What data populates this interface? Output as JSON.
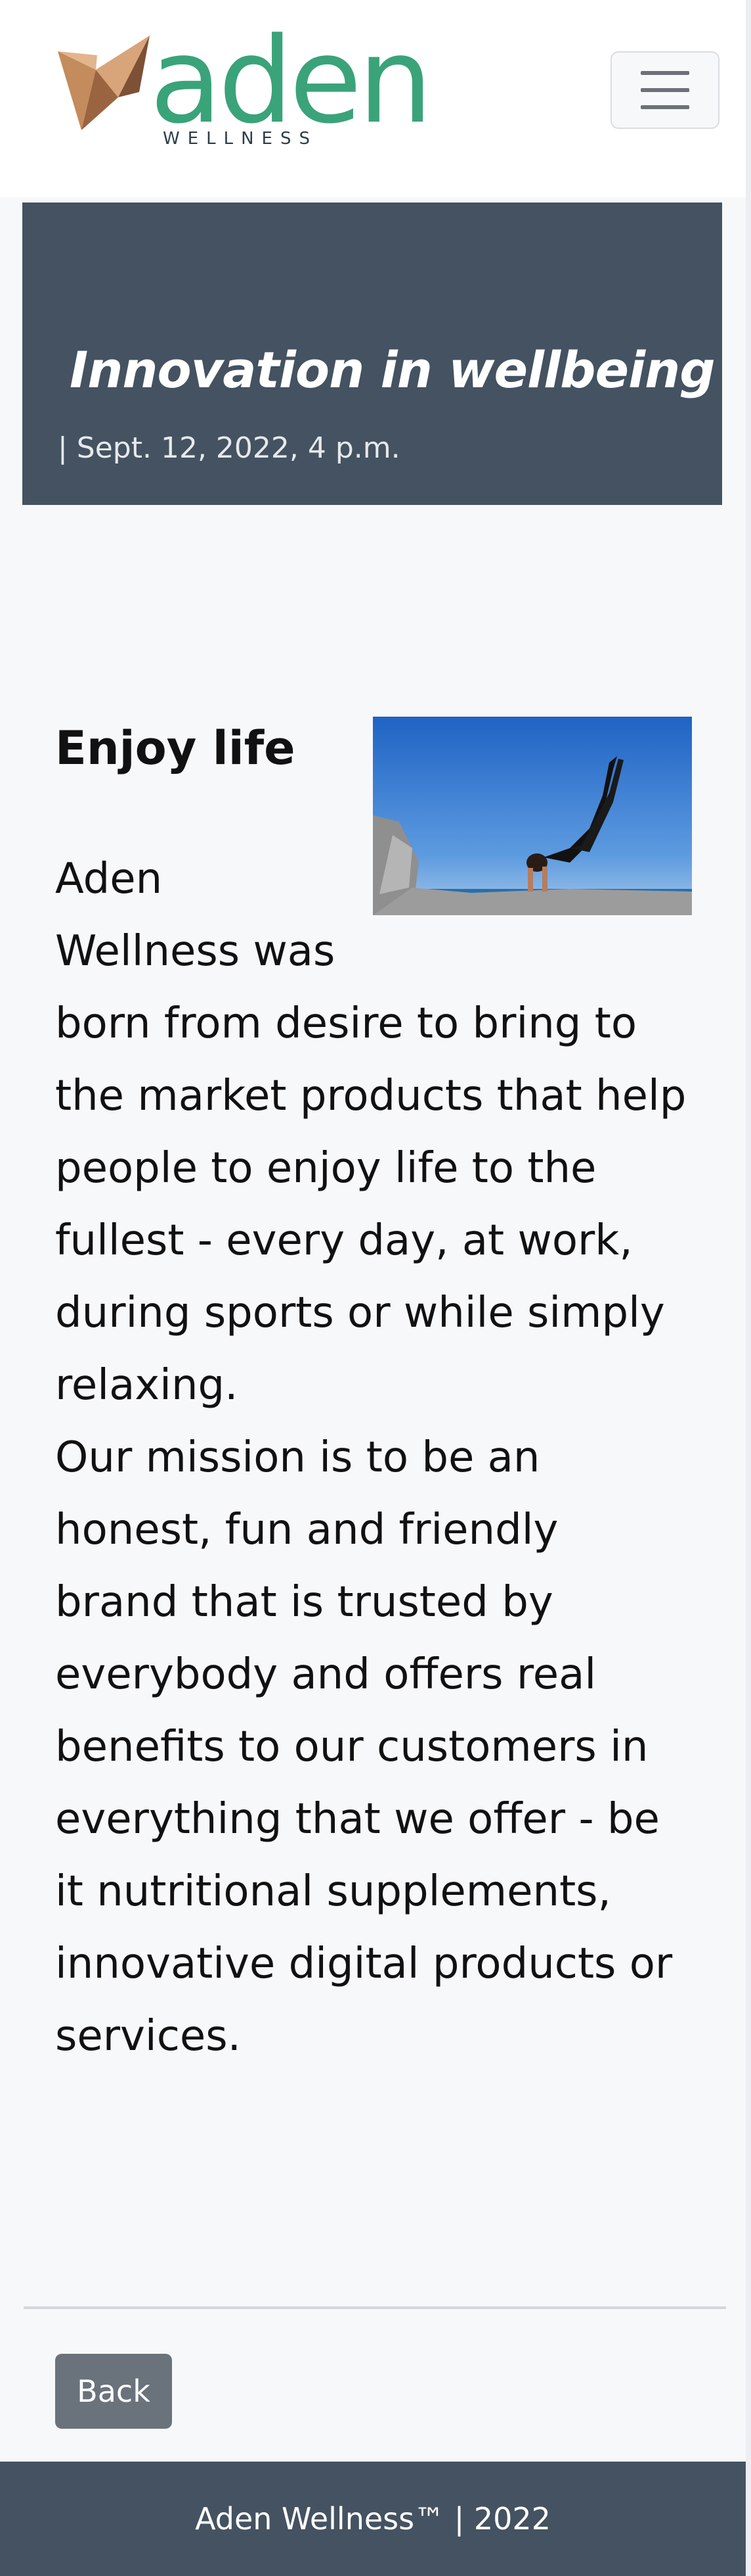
{
  "header": {
    "logo_word": "aden",
    "logo_subtitle": "WELLNESS",
    "menu_icon": "hamburger-menu-icon"
  },
  "hero": {
    "title": "Innovation in wellbeing",
    "date": "| Sept. 12, 2022, 4 p.m."
  },
  "article": {
    "heading": "Enjoy life",
    "image_alt_icon": "yoga-photo",
    "paragraph_1": "Aden Wellness was born from desire to bring to the market products that help people to enjoy life to the fullest - every day, at work, during sports or while simply relaxing.",
    "paragraph_2": "Our mission is to be an honest, fun and friendly brand that is trusted by everybody and offers real benefits to our customers in everything that we offer - be it nutritional supplements, innovative digital products or services."
  },
  "actions": {
    "back_label": "Back"
  },
  "footer": {
    "text": "Aden Wellness™ | 2022"
  },
  "colors": {
    "brand_green": "#3aa37a",
    "brand_copper": "#b07a4e",
    "hero_bg": "#445261",
    "button_bg": "#6a737c"
  }
}
